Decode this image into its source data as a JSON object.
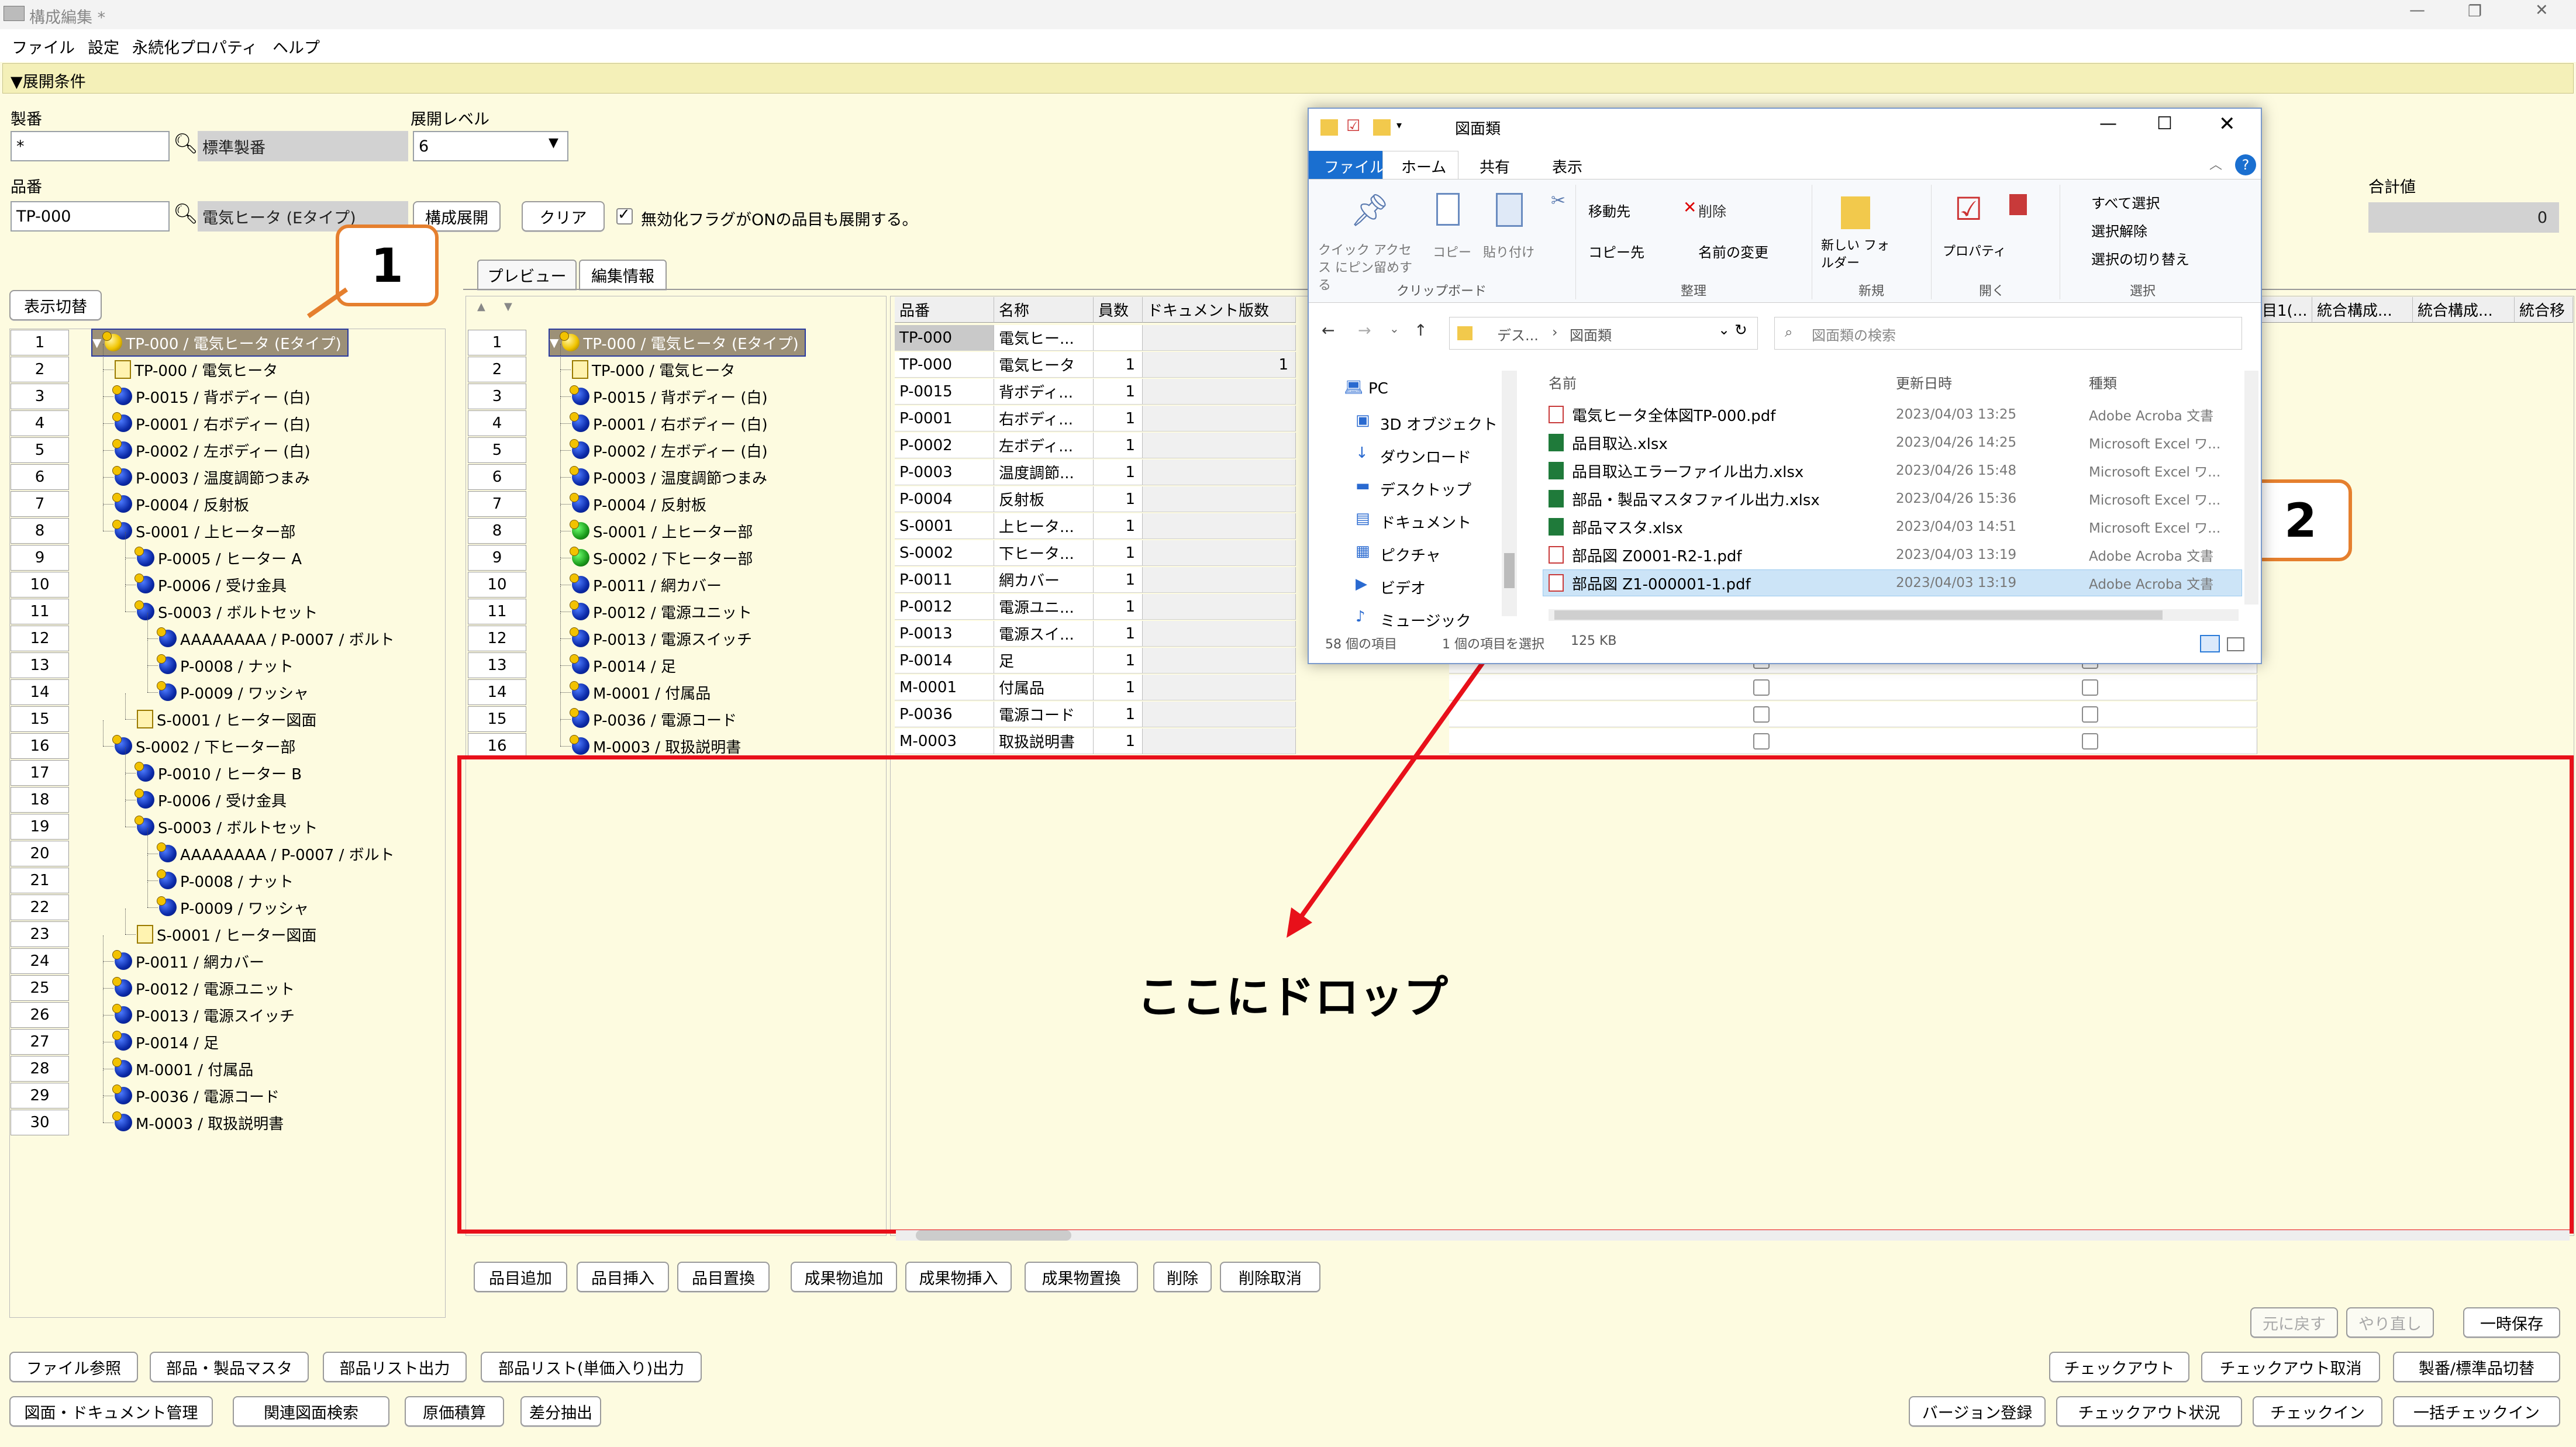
{
  "window": {
    "title": "構成編集 *",
    "menu": [
      "ファイル",
      "設定",
      "永続化プロパティ",
      "ヘルプ"
    ]
  },
  "cond": {
    "header": "▼展開条件",
    "seiban_label": "製番",
    "seiban_value": "*",
    "seiban_name": "標準製番",
    "level_label": "展開レベル",
    "level_value": "6",
    "hinban_label": "品番",
    "hinban_value": "TP-000",
    "hinban_name": "電気ヒータ (Eタイプ)",
    "expand_btn": "構成展開",
    "clear_btn": "クリア",
    "checkbox_label": "無効化フラグがONの品目も展開する。",
    "total_label": "合計値",
    "total_value": "0"
  },
  "left": {
    "switch_btn": "表示切替",
    "rows": [
      {
        "n": "1",
        "t": "TP-000 / 電気ヒータ (Eタイプ)",
        "d": 0,
        "i": "y"
      },
      {
        "n": "2",
        "t": "TP-000 / 電気ヒータ",
        "d": 1,
        "i": "doc"
      },
      {
        "n": "3",
        "t": "P-0015 / 背ボディー (白)",
        "d": 1,
        "i": "b"
      },
      {
        "n": "4",
        "t": "P-0001 / 右ボディー (白)",
        "d": 1,
        "i": "b"
      },
      {
        "n": "5",
        "t": "P-0002 / 左ボディー (白)",
        "d": 1,
        "i": "b"
      },
      {
        "n": "6",
        "t": "P-0003 / 温度調節つまみ",
        "d": 1,
        "i": "b"
      },
      {
        "n": "7",
        "t": "P-0004 / 反射板",
        "d": 1,
        "i": "b"
      },
      {
        "n": "8",
        "t": "S-0001 / 上ヒーター部",
        "d": 1,
        "i": "b"
      },
      {
        "n": "9",
        "t": "P-0005 / ヒーター A",
        "d": 2,
        "i": "b"
      },
      {
        "n": "10",
        "t": "P-0006 / 受け金具",
        "d": 2,
        "i": "b"
      },
      {
        "n": "11",
        "t": "S-0003 / ボルトセット",
        "d": 2,
        "i": "b"
      },
      {
        "n": "12",
        "t": "AAAAAAAA / P-0007 / ボルト",
        "d": 3,
        "i": "b"
      },
      {
        "n": "13",
        "t": "P-0008 / ナット",
        "d": 3,
        "i": "b"
      },
      {
        "n": "14",
        "t": "P-0009 / ワッシャ",
        "d": 3,
        "i": "b"
      },
      {
        "n": "15",
        "t": "S-0001 / ヒーター図面",
        "d": 2,
        "i": "doc"
      },
      {
        "n": "16",
        "t": "S-0002 / 下ヒーター部",
        "d": 1,
        "i": "b"
      },
      {
        "n": "17",
        "t": "P-0010 / ヒーター B",
        "d": 2,
        "i": "b"
      },
      {
        "n": "18",
        "t": "P-0006 / 受け金具",
        "d": 2,
        "i": "b"
      },
      {
        "n": "19",
        "t": "S-0003 / ボルトセット",
        "d": 2,
        "i": "b"
      },
      {
        "n": "20",
        "t": "AAAAAAAA / P-0007 / ボルト",
        "d": 3,
        "i": "b"
      },
      {
        "n": "21",
        "t": "P-0008 / ナット",
        "d": 3,
        "i": "b"
      },
      {
        "n": "22",
        "t": "P-0009 / ワッシャ",
        "d": 3,
        "i": "b"
      },
      {
        "n": "23",
        "t": "S-0001 / ヒーター図面",
        "d": 2,
        "i": "doc"
      },
      {
        "n": "24",
        "t": "P-0011 / 網カバー",
        "d": 1,
        "i": "b"
      },
      {
        "n": "25",
        "t": "P-0012 / 電源ユニット",
        "d": 1,
        "i": "b"
      },
      {
        "n": "26",
        "t": "P-0013 / 電源スイッチ",
        "d": 1,
        "i": "b"
      },
      {
        "n": "27",
        "t": "P-0014 / 足",
        "d": 1,
        "i": "b"
      },
      {
        "n": "28",
        "t": "M-0001 / 付属品",
        "d": 1,
        "i": "b"
      },
      {
        "n": "29",
        "t": "P-0036 / 電源コード",
        "d": 1,
        "i": "b"
      },
      {
        "n": "30",
        "t": "M-0003 / 取扱説明書",
        "d": 1,
        "i": "b"
      }
    ]
  },
  "tabs": [
    "プレビュー",
    "編集情報"
  ],
  "edit": {
    "rows": [
      {
        "n": "1",
        "t": "TP-000 / 電気ヒータ (Eタイプ)",
        "d": 0,
        "i": "y"
      },
      {
        "n": "2",
        "t": "TP-000 / 電気ヒータ",
        "d": 1,
        "i": "doc"
      },
      {
        "n": "3",
        "t": "P-0015 / 背ボディー (白)",
        "d": 1,
        "i": "b"
      },
      {
        "n": "4",
        "t": "P-0001 / 右ボディー (白)",
        "d": 1,
        "i": "b"
      },
      {
        "n": "5",
        "t": "P-0002 / 左ボディー (白)",
        "d": 1,
        "i": "b"
      },
      {
        "n": "6",
        "t": "P-0003 / 温度調節つまみ",
        "d": 1,
        "i": "b"
      },
      {
        "n": "7",
        "t": "P-0004 / 反射板",
        "d": 1,
        "i": "b"
      },
      {
        "n": "8",
        "t": "S-0001 / 上ヒーター部",
        "d": 1,
        "i": "g"
      },
      {
        "n": "9",
        "t": "S-0002 / 下ヒーター部",
        "d": 1,
        "i": "g"
      },
      {
        "n": "10",
        "t": "P-0011 / 網カバー",
        "d": 1,
        "i": "b"
      },
      {
        "n": "11",
        "t": "P-0012 / 電源ユニット",
        "d": 1,
        "i": "b"
      },
      {
        "n": "12",
        "t": "P-0013 / 電源スイッチ",
        "d": 1,
        "i": "b"
      },
      {
        "n": "13",
        "t": "P-0014 / 足",
        "d": 1,
        "i": "b"
      },
      {
        "n": "14",
        "t": "M-0001 / 付属品",
        "d": 1,
        "i": "b"
      },
      {
        "n": "15",
        "t": "P-0036 / 電源コード",
        "d": 1,
        "i": "b"
      },
      {
        "n": "16",
        "t": "M-0003 / 取扱説明書",
        "d": 1,
        "i": "b"
      }
    ]
  },
  "grid": {
    "headers": [
      "品番",
      "名称",
      "員数",
      "ドキュメント版数"
    ],
    "right_headers": [
      "目1(...",
      "統合構成...",
      "統合構成...",
      "統合移"
    ],
    "rows": [
      [
        "TP-000",
        "電気ヒー...",
        "",
        ""
      ],
      [
        "TP-000",
        "電気ヒータ",
        "1",
        "1"
      ],
      [
        "P-0015",
        "背ボディ...",
        "1",
        ""
      ],
      [
        "P-0001",
        "右ボディ...",
        "1",
        ""
      ],
      [
        "P-0002",
        "左ボディ...",
        "1",
        ""
      ],
      [
        "P-0003",
        "温度調節...",
        "1",
        ""
      ],
      [
        "P-0004",
        "反射板",
        "1",
        ""
      ],
      [
        "S-0001",
        "上ヒータ...",
        "1",
        ""
      ],
      [
        "S-0002",
        "下ヒータ...",
        "1",
        ""
      ],
      [
        "P-0011",
        "網カバー",
        "1",
        ""
      ],
      [
        "P-0012",
        "電源ユニ...",
        "1",
        ""
      ],
      [
        "P-0013",
        "電源スイ...",
        "1",
        ""
      ],
      [
        "P-0014",
        "足",
        "1",
        ""
      ],
      [
        "M-0001",
        "付属品",
        "1",
        ""
      ],
      [
        "P-0036",
        "電源コード",
        "1",
        ""
      ],
      [
        "M-0003",
        "取扱説明書",
        "1",
        ""
      ]
    ]
  },
  "drop_text": "ここにドロップ",
  "callouts": [
    "1",
    "2"
  ],
  "edit_buttons": [
    "品目追加",
    "品目挿入",
    "品目置換",
    "成果物追加",
    "成果物挿入",
    "成果物置換",
    "削除",
    "削除取消"
  ],
  "undo_buttons": [
    "元に戻す",
    "やり直し",
    "一時保存"
  ],
  "bottom_left_1": [
    "ファイル参照",
    "部品・製品マスタ",
    "部品リスト出力",
    "部品リスト(単価入り)出力"
  ],
  "bottom_left_2": [
    "図面・ドキュメント管理",
    "関連図面検索",
    "原価積算",
    "差分抽出"
  ],
  "bottom_right_1": [
    "チェックアウト",
    "チェックアウト取消",
    "製番/標準品切替"
  ],
  "bottom_right_2": [
    "バージョン登録",
    "チェックアウト状況",
    "チェックイン",
    "一括チェックイン"
  ],
  "explorer": {
    "title": "図面類",
    "ribbon_tabs": [
      "ファイル",
      "ホーム",
      "共有",
      "表示"
    ],
    "clip": [
      "クイック アクセス にピン留めする",
      "コピー",
      "貼り付け"
    ],
    "clip_group": "クリップボード",
    "org": [
      "移動先",
      "削除",
      "コピー先",
      "名前の変更"
    ],
    "org_group": "整理",
    "new": [
      "新しい フォルダー"
    ],
    "new_group": "新規",
    "open": [
      "プロパティ"
    ],
    "open_group": "開く",
    "sel": [
      "すべて選択",
      "選択解除",
      "選択の切り替え"
    ],
    "sel_group": "選択",
    "path": [
      "デス...",
      "図面類"
    ],
    "search_placeholder": "図面類の検索",
    "nav": [
      "PC",
      "3D オブジェクト",
      "ダウンロード",
      "デスクトップ",
      "ドキュメント",
      "ピクチャ",
      "ビデオ",
      "ミュージック"
    ],
    "cols": [
      "名前",
      "更新日時",
      "種類"
    ],
    "files": [
      {
        "name": "電気ヒータ全体図TP-000.pdf",
        "date": "2023/04/03 13:25",
        "type": "Adobe Acroba 文書",
        "kind": "pdf"
      },
      {
        "name": "品目取込.xlsx",
        "date": "2023/04/26 14:25",
        "type": "Microsoft Excel ワ...",
        "kind": "xls"
      },
      {
        "name": "品目取込エラーファイル出力.xlsx",
        "date": "2023/04/26 15:48",
        "type": "Microsoft Excel ワ...",
        "kind": "xls"
      },
      {
        "name": "部品・製品マスタファイル出力.xlsx",
        "date": "2023/04/26 15:36",
        "type": "Microsoft Excel ワ...",
        "kind": "xls"
      },
      {
        "name": "部品マスタ.xlsx",
        "date": "2023/04/03 14:51",
        "type": "Microsoft Excel ワ...",
        "kind": "xls"
      },
      {
        "name": "部品図 Z0001-R2-1.pdf",
        "date": "2023/04/03 13:19",
        "type": "Adobe Acroba 文書",
        "kind": "pdf"
      },
      {
        "name": "部品図 Z1-000001-1.pdf",
        "date": "2023/04/03 13:19",
        "type": "Adobe Acroba 文書",
        "kind": "pdf"
      }
    ],
    "status": [
      "58 個の項目",
      "1 個の項目を選択",
      "125 KB"
    ]
  }
}
